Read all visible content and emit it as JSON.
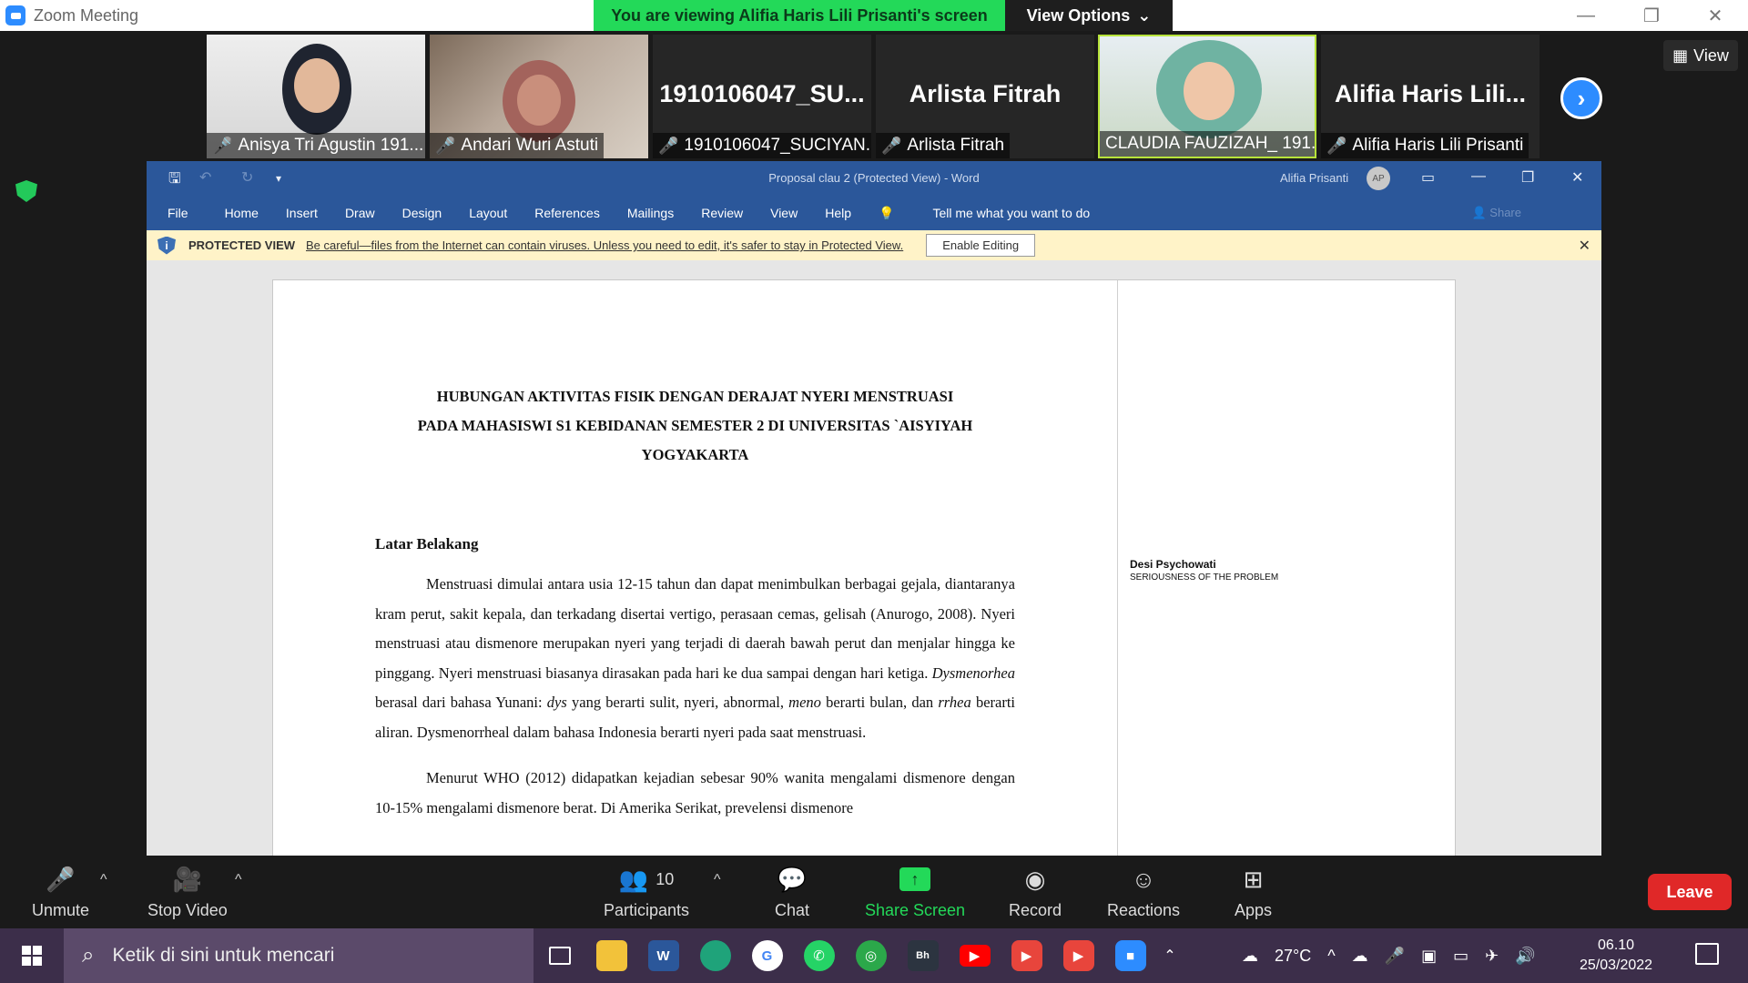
{
  "zoom": {
    "window_title": "Zoom Meeting",
    "viewing_banner": "You are viewing Alifia Haris Lili Prisanti's screen",
    "view_options": "View Options",
    "view_label": "View"
  },
  "gallery": {
    "tiles": [
      {
        "label": "Anisya Tri Agustin 191...",
        "big": ""
      },
      {
        "label": "Andari Wuri Astuti",
        "big": ""
      },
      {
        "label": "1910106047_SUCIYAN...",
        "big": "1910106047_SU..."
      },
      {
        "label": "Arlista Fitrah",
        "big": "Arlista Fitrah"
      },
      {
        "label": "CLAUDIA FAUZIZAH_ 191...",
        "big": ""
      },
      {
        "label": "Alifia Haris Lili Prisanti",
        "big": "Alifia Haris Lili..."
      }
    ]
  },
  "word": {
    "title": "Proposal clau 2 (Protected View)  -  Word",
    "user": "Alifia Prisanti",
    "avatar": "AP",
    "ribbon": [
      "File",
      "Home",
      "Insert",
      "Draw",
      "Design",
      "Layout",
      "References",
      "Mailings",
      "Review",
      "View",
      "Help"
    ],
    "tell_me": "Tell me what you want to do",
    "share": "Share",
    "protected_label": "PROTECTED VIEW",
    "protected_msg": "Be careful—files from the Internet can contain viruses. Unless you need to edit, it's safer to stay in Protected View.",
    "enable_editing": "Enable Editing"
  },
  "document": {
    "title_lines": [
      "HUBUNGAN AKTIVITAS FISIK DENGAN DERAJAT NYERI MENSTRUASI",
      "PADA MAHASISWI S1 KEBIDANAN SEMESTER 2 DI UNIVERSITAS `AISYIYAH",
      "YOGYAKARTA"
    ],
    "heading": "Latar Belakang",
    "p1a": "Menstruasi dimulai antara usia 12-15 tahun dan dapat menimbulkan berbagai gejala, diantaranya kram perut, sakit kepala, dan terkadang disertai vertigo, perasaan cemas, gelisah (Anurogo, 2008). Nyeri menstruasi atau dismenore merupakan nyeri yang terjadi di daerah bawah perut dan menjalar hingga ke pinggang. Nyeri menstruasi biasanya dirasakan pada hari ke dua sampai dengan hari ketiga. ",
    "p1_dys": "Dysmenorhea",
    "p1b": " berasal dari bahasa Yunani: ",
    "p1_dys2": "dys",
    "p1c": " yang berarti sulit, nyeri, abnormal, ",
    "p1_meno": "meno",
    "p1d": " berarti bulan, dan ",
    "p1_rrhea": "rrhea",
    "p1e": " berarti aliran. Dysmenorrheal dalam bahasa Indonesia berarti nyeri pada saat menstruasi.",
    "p2": "Menurut WHO (2012) didapatkan kejadian sebesar 90% wanita mengalami dismenore dengan 10-15% mengalami dismenore berat. Di Amerika Serikat, prevelensi dismenore"
  },
  "comment": {
    "author": "Desi Psychowati",
    "text": "SERIOUSNESS OF THE PROBLEM"
  },
  "controls": {
    "unmute": "Unmute",
    "stop_video": "Stop Video",
    "participants": "Participants",
    "participants_count": "10",
    "chat": "Chat",
    "share_screen": "Share Screen",
    "record": "Record",
    "reactions": "Reactions",
    "apps": "Apps",
    "leave": "Leave"
  },
  "taskbar": {
    "search_placeholder": "Ketik di sini untuk mencari",
    "temperature": "27°C",
    "time": "06.10",
    "date": "25/03/2022"
  },
  "colors": {
    "zoom_green": "#23d959",
    "word_blue": "#2b579a",
    "protected_yellow": "#fff3c8",
    "leave_red": "#e02828",
    "taskbar": "#3c2e4a"
  }
}
